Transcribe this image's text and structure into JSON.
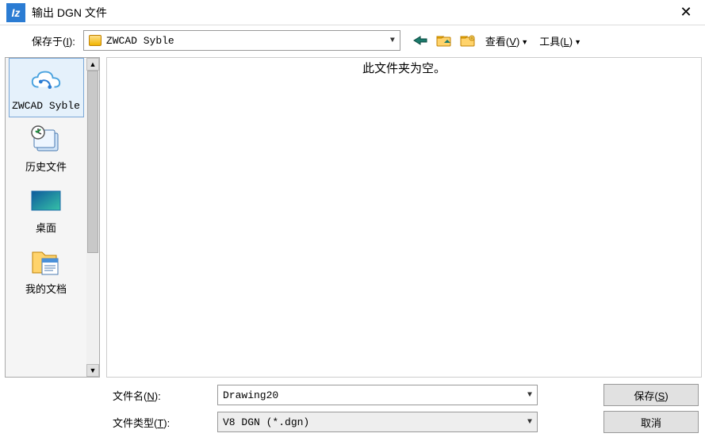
{
  "title": "输出 DGN 文件",
  "toolbar": {
    "savein_label": "保存于(I):",
    "location": "ZWCAD Syble",
    "view_label": "查看(V)",
    "tools_label": "工具(L)"
  },
  "sidebar": {
    "items": [
      {
        "label": "ZWCAD Syble"
      },
      {
        "label": "历史文件"
      },
      {
        "label": "桌面"
      },
      {
        "label": "我的文档"
      }
    ]
  },
  "filelist": {
    "empty_text": "此文件夹为空。"
  },
  "footer": {
    "filename_label": "文件名(N):",
    "filename_value": "Drawing20",
    "filetype_label": "文件类型(T):",
    "filetype_value": "V8 DGN (*.dgn)",
    "save_label": "保存(S)",
    "cancel_label": "取消"
  }
}
